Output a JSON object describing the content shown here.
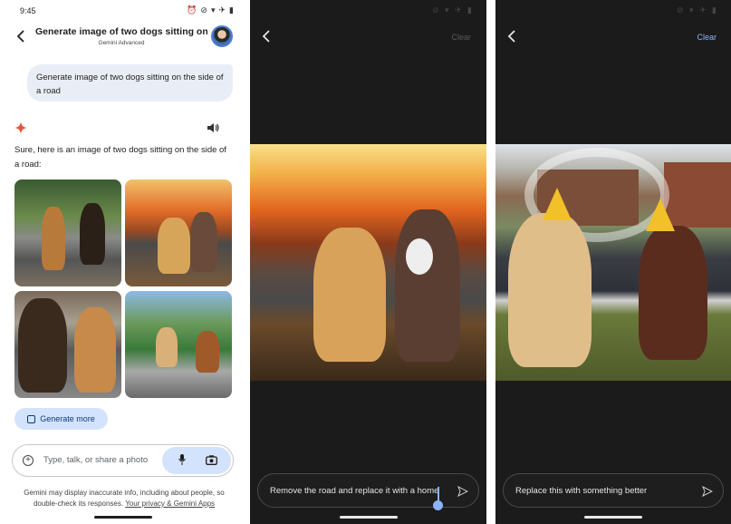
{
  "panel1": {
    "status_time": "9:45",
    "header_title": "Generate image of two dogs sitting on t...",
    "header_subtitle": "Gemini Advanced",
    "prompt": "Generate image of two dogs sitting on the side of a road",
    "response": "Sure, here is an image of two dogs sitting on the side of a road:",
    "generate_more_label": "Generate more",
    "input_placeholder": "Type, talk, or share a photo",
    "disclaimer_text": "Gemini may display inaccurate info, including about people, so double-check its responses.",
    "disclaimer_link": "Your privacy & Gemini Apps"
  },
  "panel2": {
    "clear_label": "Clear",
    "input_text": "Remove the road and replace it with a home"
  },
  "panel3": {
    "clear_label": "Clear",
    "input_text": "Replace this with something better"
  },
  "colors": {
    "accent": "#8ab4f8",
    "chip_bg": "#d3e3fd",
    "bubble_bg": "#e9eef6",
    "dark_bg": "#1b1b1b"
  },
  "icons": [
    "back-arrow-icon",
    "gemini-sparkle-icon",
    "speaker-icon",
    "image-stack-icon",
    "add-icon",
    "mic-icon",
    "camera-icon",
    "send-icon"
  ]
}
